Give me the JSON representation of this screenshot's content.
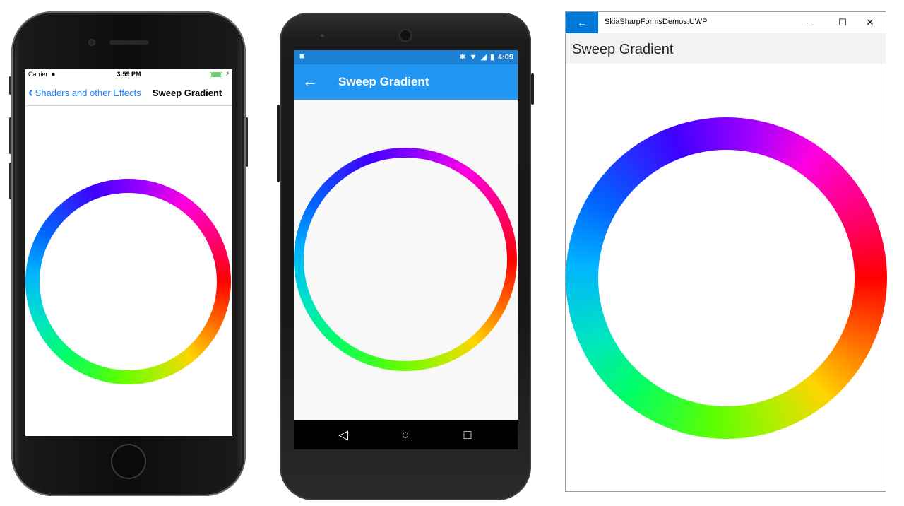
{
  "ios": {
    "carrier": "Carrier",
    "time": "3:59 PM",
    "back_label": "Shaders and other Effects",
    "title": "Sweep Gradient"
  },
  "android": {
    "time": "4:09",
    "title": "Sweep Gradient"
  },
  "uwp": {
    "app_title": "SkiaSharpFormsDemos.UWP",
    "page_title": "Sweep Gradient"
  },
  "colors": {
    "ios_tint": "#1a82fb",
    "android_appbar": "#2196f3",
    "android_statusbar": "#1b7fd4",
    "uwp_accent": "#0078d7",
    "gradient_stops": [
      "#ff0000",
      "#ffd400",
      "#5cff00",
      "#00ff66",
      "#00b4ff",
      "#4000ff",
      "#ff00e0"
    ]
  },
  "icons": {
    "ios_back": "chevron-left-icon",
    "android_back": "arrow-left-icon",
    "android_nav": [
      "back-triangle-icon",
      "home-circle-icon",
      "recents-square-icon"
    ],
    "uwp_controls": [
      "minimize-icon",
      "maximize-icon",
      "close-icon"
    ]
  }
}
